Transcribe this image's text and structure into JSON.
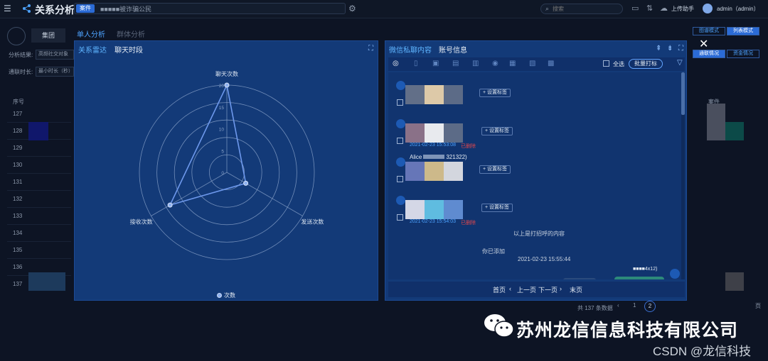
{
  "app": {
    "title": "关系分析",
    "case_tag": "案件",
    "case_name": "■■■■■被诈骗公民",
    "search_placeholder": "搜索",
    "upload_label": "上传助手",
    "user": "admin（admin）"
  },
  "background": {
    "profile_tab": "集团",
    "tabs": [
      "单人分析",
      "群体分析"
    ],
    "filter_label_1": "分析结果:",
    "filter_value_1": "高频社交对象",
    "filter_label_2": "通联时长:",
    "filter_placeholder_2": "最小时长（秒）",
    "mode_buttons": [
      "图谱模式",
      "列表模式",
      "通联情况",
      "资金情况"
    ],
    "table_header_index": "序号",
    "table_header_right": "案件",
    "rows": [
      "127",
      "128",
      "129",
      "130",
      "131",
      "132",
      "133",
      "134",
      "135",
      "136",
      "137"
    ],
    "pager_total": "共 137 条数据",
    "pager_pages": [
      "1",
      "2"
    ],
    "pager_jump": "页"
  },
  "radar_panel": {
    "tabs": [
      "关系雷达",
      "聊天时段"
    ],
    "legend": "次数"
  },
  "chart_data": {
    "type": "radar",
    "indicators": [
      "聊天次数",
      "发送次数",
      "接收次数"
    ],
    "series": [
      {
        "name": "次数",
        "values": [
          20,
          5,
          15
        ]
      }
    ],
    "max": 20,
    "ticks": [
      0,
      5,
      10,
      15,
      20
    ],
    "colors": {
      "line": "#6d98ec",
      "point": "#8fb2f0"
    }
  },
  "chat_panel": {
    "tabs": [
      "微信私聊内容",
      "账号信息"
    ],
    "select_all": "全选",
    "batch_tag": "批量打标",
    "tag_label": "+ 设置标签",
    "messages": [
      {
        "time": "",
        "status": ""
      },
      {
        "time": "2021-02-23 15:53:08",
        "status": "已删除"
      },
      {
        "time": "",
        "status": "",
        "sender": "Alice",
        "sender_suffix": "321322)"
      },
      {
        "time": "2021-02-23 15:54:03",
        "status": "已删除"
      }
    ],
    "system_note": "以上是打招呼的内容",
    "recall_note": "你已添加",
    "center_time": "2021-02-23 15:55:44",
    "right_sender": "■■■■4x12)",
    "pager": [
      "首页",
      "上一页",
      "下一页",
      "末页"
    ]
  },
  "watermark": {
    "company": "苏州龙信信息科技有限公司",
    "csdn": "CSDN @龙信科技"
  }
}
